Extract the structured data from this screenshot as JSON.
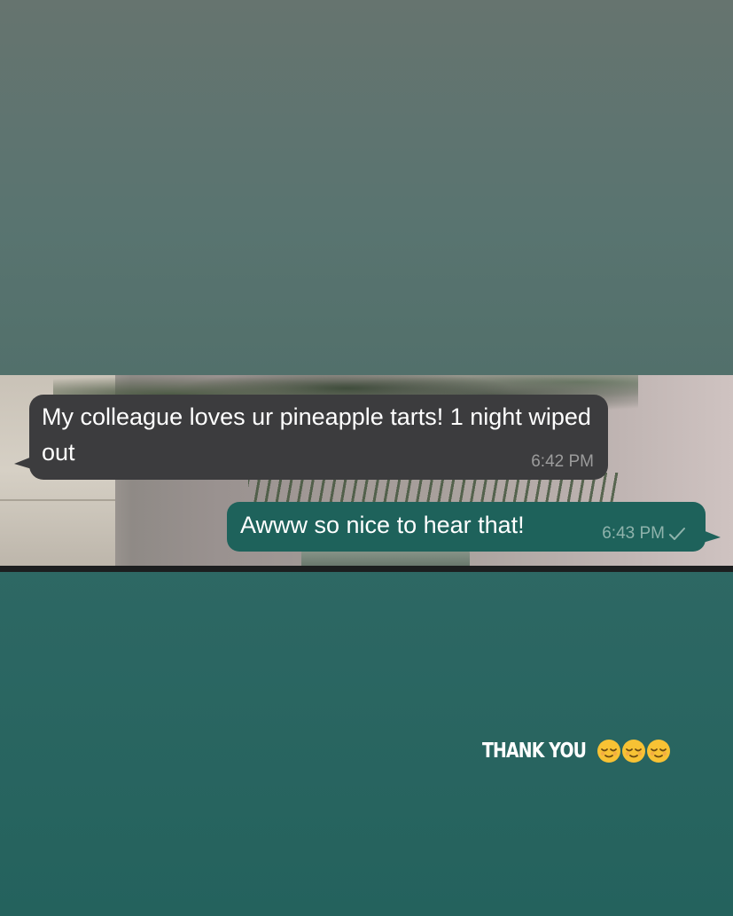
{
  "chat": {
    "incoming": {
      "text": "My colleague loves ur pineapple tarts! 1 night wiped out",
      "time": "6:42 PM"
    },
    "outgoing": {
      "text": "Awww so nice to hear that!",
      "time": "6:43 PM",
      "status_icon": "single-check-icon"
    }
  },
  "story": {
    "caption": "THANK YOU",
    "emoji_icon": "relieved-face-emoji",
    "emoji_count": 3
  },
  "colors": {
    "incoming_bubble": "#3c3c3e",
    "outgoing_bubble": "#1e625b",
    "background_top": "#65736f",
    "background_bottom": "#24625d"
  }
}
